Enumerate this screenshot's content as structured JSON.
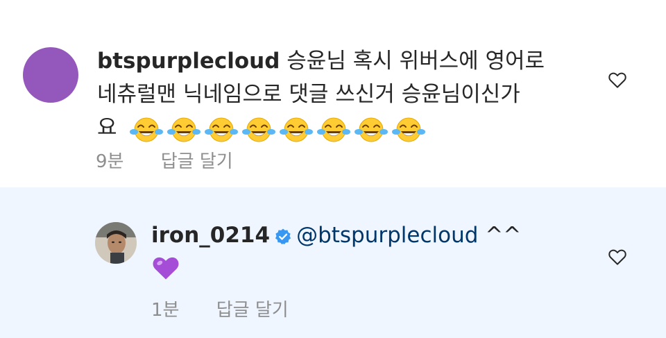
{
  "comments": [
    {
      "username": "btspurplecloud",
      "text": "승윤님 혹시 위버스에 영어로 네츄럴맨 닉네임으로 댓글 쓰신거 승윤님이신가요",
      "line1": "승윤님 혹시 위버스에 영어로",
      "line2": "네츄럴맨 닉네임으로 댓글 쓰신거 승윤님이신가",
      "line3": "요",
      "emoji": "face-with-tears-of-joy",
      "emoji_count": 8,
      "time": "9분",
      "reply_label": "답글 달기",
      "avatar_color": "#9458bd"
    }
  ],
  "reply": {
    "username": "iron_0214",
    "verified": true,
    "mention": "@btspurplecloud",
    "text": "^^",
    "emoji": "purple-heart",
    "time": "1분",
    "reply_label": "답글 달기"
  },
  "colors": {
    "reply_background": "#eff6ff",
    "mention": "#00376b",
    "meta": "#8e8e8e",
    "verified": "#3897f0",
    "heart_emoji": "#a64dd8"
  },
  "icons": {
    "like": "heart-outline-icon",
    "verified": "verified-badge-icon"
  }
}
